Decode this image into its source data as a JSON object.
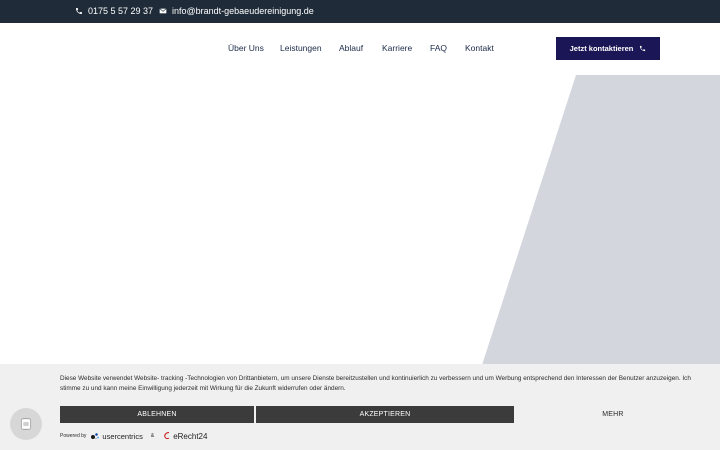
{
  "topbar": {
    "phone": "0175 5 57 29 37",
    "email": "info@brandt-gebaeudereinigung.de"
  },
  "nav": {
    "items": [
      "Über Uns",
      "Leistungen",
      "Ablauf",
      "Karriere",
      "FAQ",
      "Kontakt"
    ],
    "cta_label": "Jetzt kontaktieren"
  },
  "cookie": {
    "text": "Diese Website verwendet Website- tracking -Technologien von Drittanbietern, um unsere Dienste bereitzustellen und kontinuierlich zu verbessern und um Werbung entsprechend den Interessen der Benutzer anzuzeigen. Ich stimme zu und kann meine Einwilligung jederzeit mit Wirkung für die Zukunft widerrufen oder ändern.",
    "decline_label": "ABLEHNEN",
    "accept_label": "AKZEPTIEREN",
    "more_label": "MEHR",
    "powered_by": "Powered by",
    "usercentrics": "usercentrics",
    "amp": "&",
    "erecht": "eRecht24"
  },
  "colors": {
    "topbar": "#1f2b38",
    "cta": "#1b1656",
    "hero_shape": "#d3d6dd",
    "cookie_bg": "#f0f0f0",
    "button_dark": "#3b3b3b"
  },
  "icons": {
    "phone": "phone-icon",
    "mail": "mail-icon",
    "cta": "phone-icon",
    "privacy": "fingerprint-icon"
  }
}
